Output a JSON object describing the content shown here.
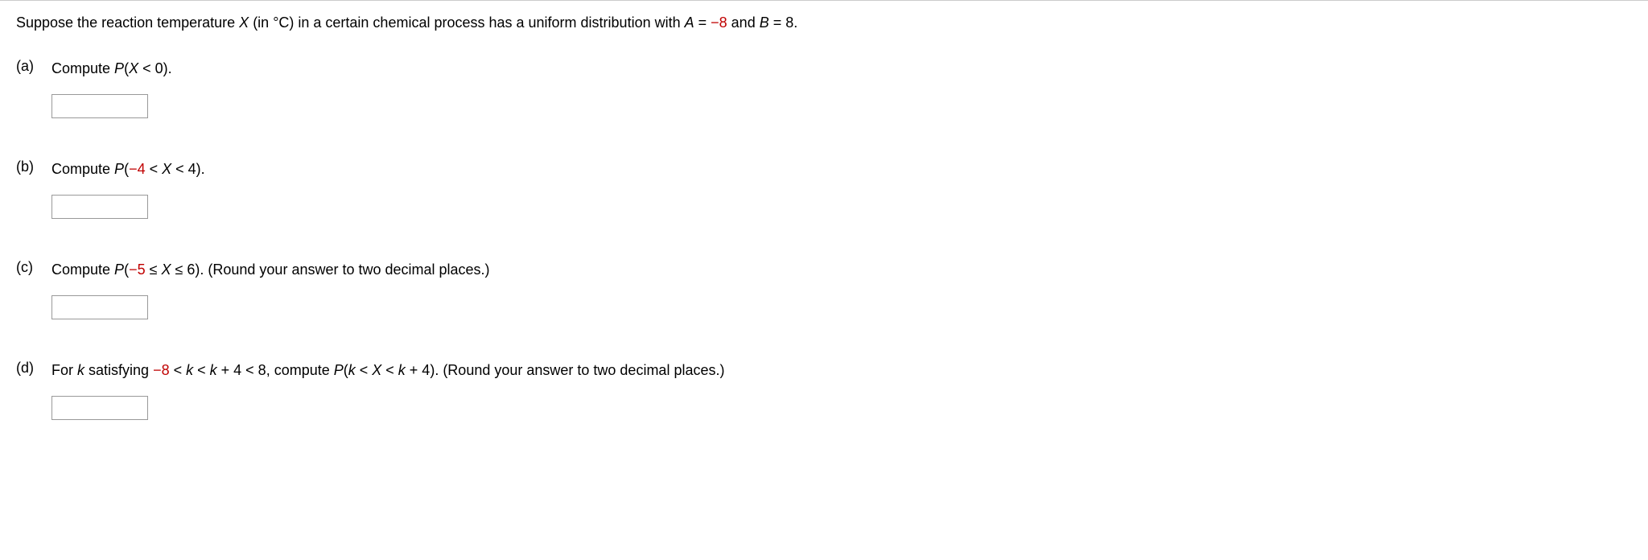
{
  "intro": {
    "pre": "Suppose the reaction temperature ",
    "var1": "X",
    "mid1": " (in °C) in a certain chemical process has a uniform distribution with ",
    "var2": "A",
    "eq1": " = ",
    "neg8": "−8",
    "mid2": " and ",
    "var3": "B",
    "eq2": " = ",
    "val8": "8.",
    "post": ""
  },
  "parts": {
    "a": {
      "label": "(a)",
      "q_pre": "Compute ",
      "q_var": "P",
      "q_open": "(",
      "q_x": "X",
      "q_rest": " < 0)."
    },
    "b": {
      "label": "(b)",
      "q_pre": "Compute ",
      "q_var": "P",
      "q_open": "(",
      "q_neg4": "−4",
      "q_lt1": " < ",
      "q_x": "X",
      "q_rest": " < 4)."
    },
    "c": {
      "label": "(c)",
      "q_pre": "Compute ",
      "q_var": "P",
      "q_open": "(",
      "q_neg5": "−5",
      "q_le1": " ≤ ",
      "q_x": "X",
      "q_rest": " ≤ 6). (Round your answer to two decimal places.)"
    },
    "d": {
      "label": "(d)",
      "q_pre": "For ",
      "q_k1": "k",
      "q_sat": " satisfying ",
      "q_neg8": "−8",
      "q_lt1": " < ",
      "q_k2": "k",
      "q_lt2": " < ",
      "q_k3": "k",
      "q_plus4a": " + 4 < 8",
      "q_comma": ", compute ",
      "q_var": "P",
      "q_open": "(",
      "q_k4": "k",
      "q_lt3": " < ",
      "q_x": "X",
      "q_lt4": " < ",
      "q_k5": "k",
      "q_rest": " + 4). (Round your answer to two decimal places.)"
    }
  }
}
